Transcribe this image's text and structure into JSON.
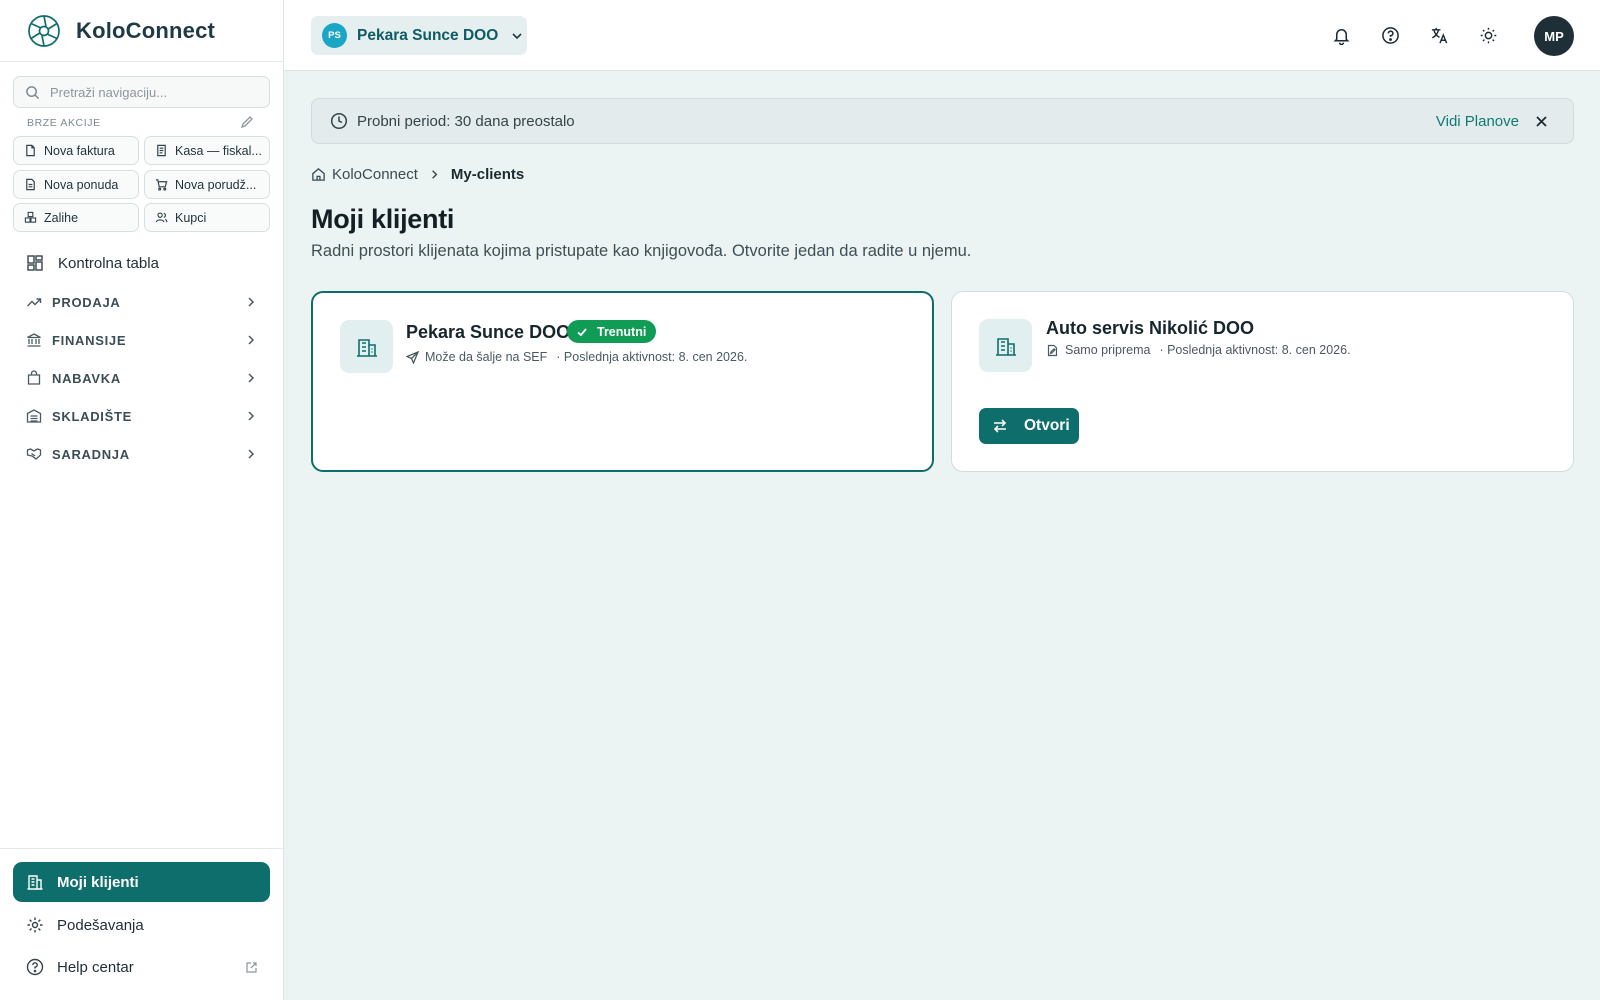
{
  "app": {
    "name": "KoloConnect"
  },
  "sidebar": {
    "search_placeholder": "Pretraži navigaciju...",
    "quick_actions_title": "BRZE AKCIJE",
    "quick_actions": [
      {
        "label": "Nova faktura",
        "icon": "file-icon"
      },
      {
        "label": "Kasa — fiskal...",
        "icon": "receipt-icon"
      },
      {
        "label": "Nova ponuda",
        "icon": "file-quote-icon"
      },
      {
        "label": "Nova porudž...",
        "icon": "cart-icon"
      },
      {
        "label": "Zalihe",
        "icon": "boxes-icon"
      },
      {
        "label": "Kupci",
        "icon": "users-icon"
      }
    ],
    "dashboard_label": "Kontrolna tabla",
    "sections": [
      {
        "label": "PRODAJA",
        "icon": "trend-up-icon"
      },
      {
        "label": "FINANSIJE",
        "icon": "bank-icon"
      },
      {
        "label": "NABAVKA",
        "icon": "shopping-bag-icon"
      },
      {
        "label": "SKLADIŠTE",
        "icon": "warehouse-icon"
      },
      {
        "label": "SARADNJA",
        "icon": "handshake-icon"
      }
    ],
    "bottom": {
      "active": "Moji klijenti",
      "settings": "Podešavanja",
      "help": "Help centar"
    }
  },
  "header": {
    "org_initials": "PS",
    "org_name": "Pekara Sunce DOO",
    "user_initials": "MP",
    "icons": [
      "bell-icon",
      "help-icon",
      "translate-icon",
      "sun-icon"
    ]
  },
  "trial": {
    "text": "Probni period: 30 dana preostalo",
    "link": "Vidi Planove"
  },
  "breadcrumb": {
    "home": "KoloConnect",
    "current": "My-clients"
  },
  "page": {
    "title": "Moji klijenti",
    "subtitle": "Radni prostori klijenata kojima pristupate kao knjigovođa. Otvorite jedan da radite u njemu."
  },
  "clients": [
    {
      "name": "Pekara Sunce DOO",
      "badge": "Trenutni",
      "status": "Može da šalje na SEF",
      "activity": "· Poslednja aktivnost: 8. cen 2026."
    },
    {
      "name": "Auto servis Nikolić DOO",
      "status": "Samo priprema",
      "activity": "· Poslednja aktivnost: 8. cen 2026.",
      "open_label": "Otvori"
    }
  ],
  "colors": {
    "accent": "#0e6e6b",
    "badge_green": "#109c55",
    "background": "#ecf4f3"
  }
}
